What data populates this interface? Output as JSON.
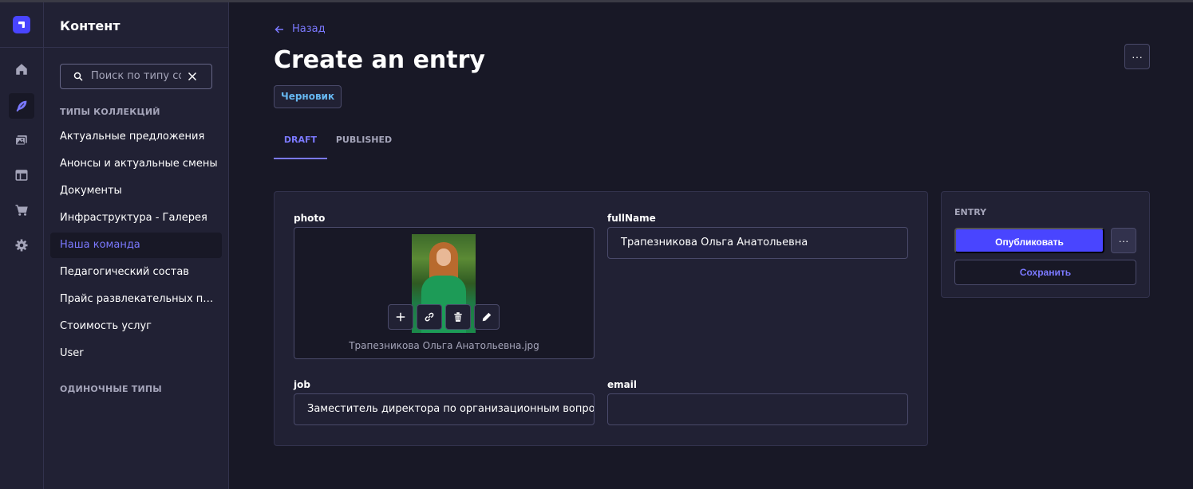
{
  "colors": {
    "accent": "#4945ff",
    "accent_text": "#7b79ff",
    "badge_text": "#66b7f1",
    "bg": "#181826",
    "panel": "#212134"
  },
  "rail": {
    "logo_icon": "strapi-logo-icon",
    "icons": [
      "home-icon",
      "content-manager-icon",
      "media-library-icon",
      "layout-builder-icon",
      "marketplace-icon",
      "settings-icon"
    ]
  },
  "subnav": {
    "title": "Контент",
    "search_placeholder": "Поиск по типу содержимого",
    "collection_types_label": "ТИПЫ КОЛЛЕКЦИЙ",
    "items": [
      {
        "label": "Актуальные предложения"
      },
      {
        "label": "Анонсы и актуальные смены"
      },
      {
        "label": "Документы"
      },
      {
        "label": "Инфраструктура - Галерея"
      },
      {
        "label": "Наша команда"
      },
      {
        "label": "Педагогический состав"
      },
      {
        "label": "Прайс развлекательных п…"
      },
      {
        "label": "Стоимость услуг"
      },
      {
        "label": "User"
      }
    ],
    "active_item": "Наша команда",
    "single_types_label": "ОДИНОЧНЫЕ ТИПЫ"
  },
  "header": {
    "back_label": "Назад",
    "title": "Create an entry",
    "status_badge": "Черновик",
    "more_label": "···"
  },
  "tabs": [
    {
      "label": "DRAFT",
      "active": true
    },
    {
      "label": "PUBLISHED",
      "active": false
    }
  ],
  "form": {
    "photo": {
      "label": "photo",
      "filename": "Трапезникова Ольга Анатольевна.jpg"
    },
    "fullName": {
      "label": "fullName",
      "value": "Трапезникова Ольга Анатольевна"
    },
    "job": {
      "label": "job",
      "value": "Заместитель директора по организационным вопрос"
    },
    "email": {
      "label": "email",
      "value": ""
    }
  },
  "side_panel": {
    "label": "ENTRY",
    "publish_label": "Опубликовать",
    "more_label": "···",
    "save_label": "Сохранить"
  }
}
